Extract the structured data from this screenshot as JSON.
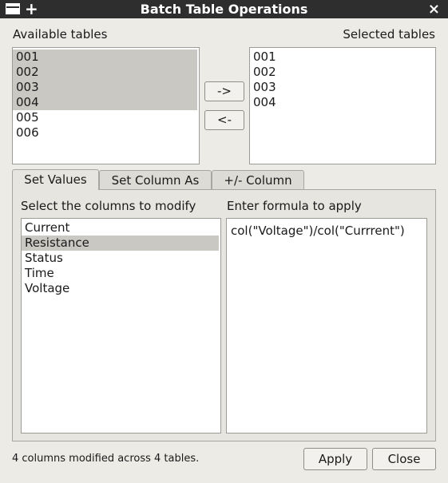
{
  "window": {
    "title": "Batch Table Operations",
    "plus_glyph": "+",
    "close_glyph": "×"
  },
  "available": {
    "label": "Available tables",
    "items": [
      "001",
      "002",
      "003",
      "004",
      "005",
      "006"
    ]
  },
  "selected": {
    "label": "Selected tables",
    "items": [
      "001",
      "002",
      "003",
      "004"
    ]
  },
  "transfer": {
    "add_label": "->",
    "remove_label": "<-"
  },
  "tabs": [
    {
      "label": "Set Values"
    },
    {
      "label": "Set Column As"
    },
    {
      "label": "+/- Column"
    }
  ],
  "set_values": {
    "columns_label": "Select the columns to modify",
    "columns": [
      "Current",
      "Resistance",
      "Status",
      "Time",
      "Voltage"
    ],
    "formula_label": "Enter formula to apply",
    "formula": "col(\"Voltage\")/col(\"Currrent\")"
  },
  "status": "4 columns modified across 4 tables.",
  "buttons": {
    "apply": "Apply",
    "close": "Close"
  },
  "colors": {
    "selection": "#c9c8c3",
    "titlebar": "#2e2e2e",
    "background": "#ecebe6"
  }
}
